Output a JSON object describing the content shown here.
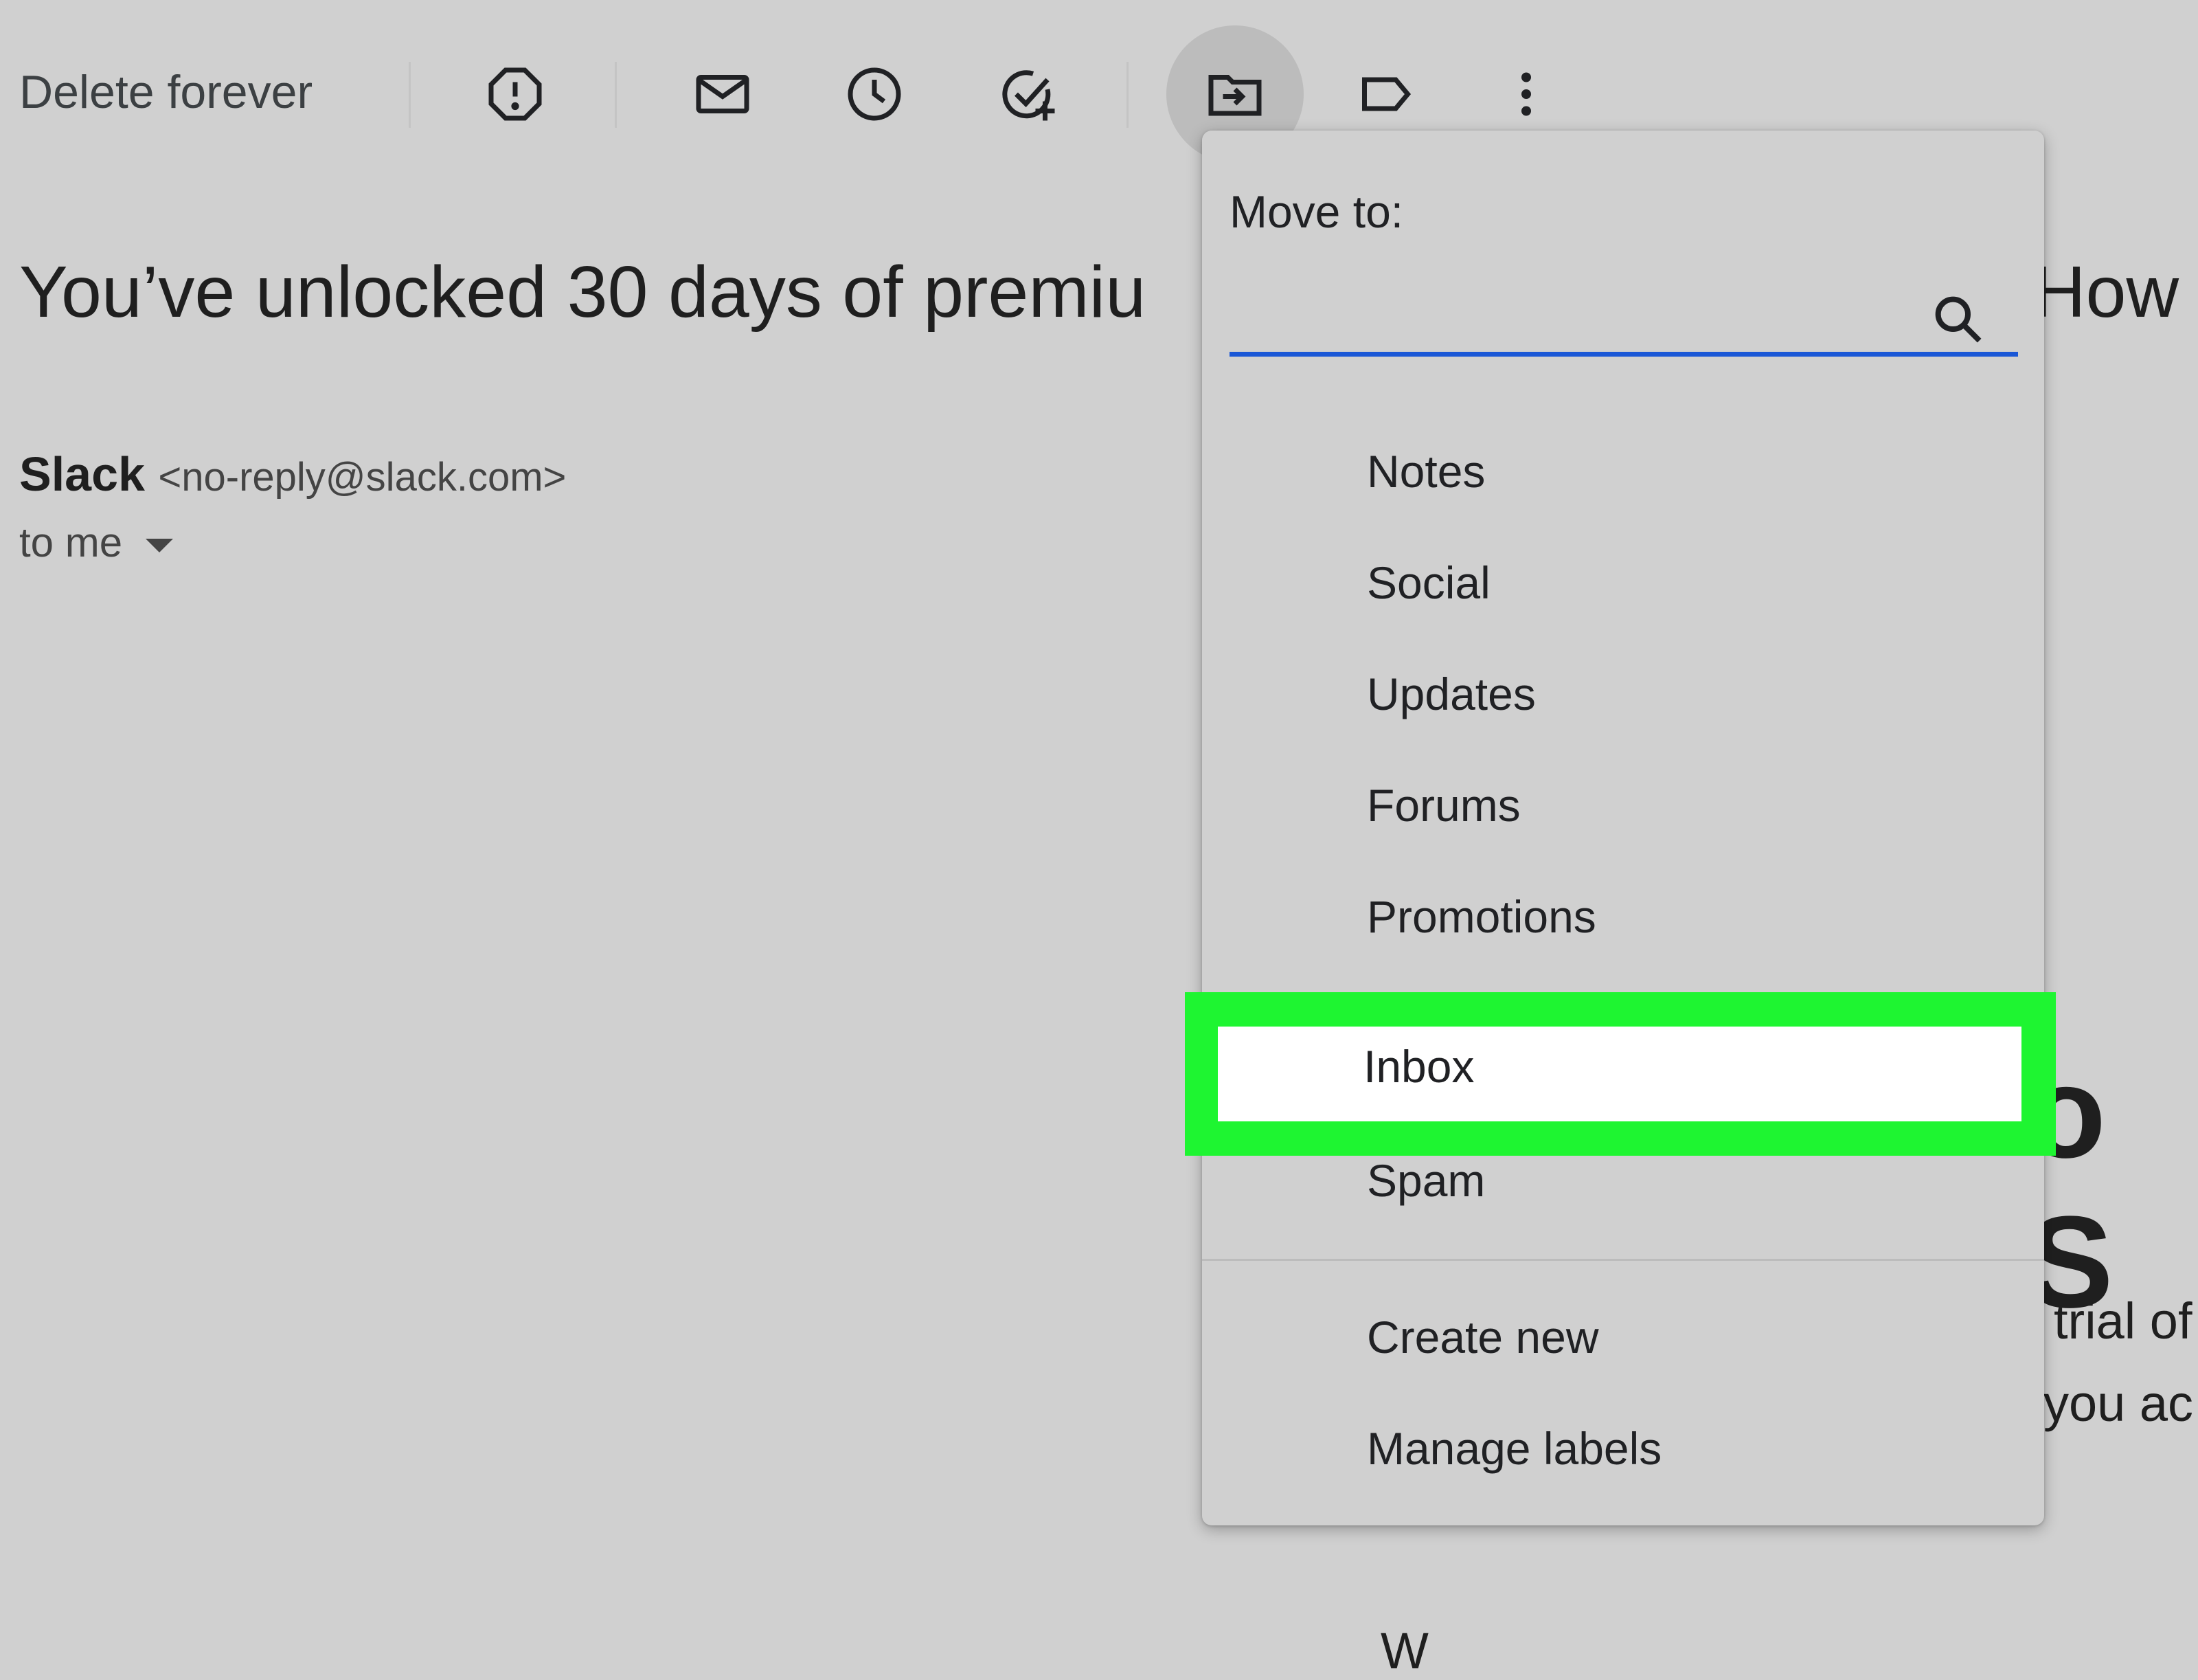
{
  "toolbar": {
    "delete_label": "Delete forever",
    "icons": [
      "report-spam-icon",
      "mark-unread-icon",
      "snooze-icon",
      "add-task-icon",
      "move-to-icon",
      "label-icon",
      "more-icon"
    ]
  },
  "email": {
    "subject_visible": "You’ve unlocked 30 days of premiu",
    "subject_tail": "How",
    "sender_name": "Slack",
    "sender_email": "<no-reply@slack.com>",
    "recipient": "to me"
  },
  "background_fragments": {
    "big": "o S",
    "line1": "trial of",
    "line2": "you ac",
    "bottom": "W"
  },
  "menu": {
    "title": "Move to:",
    "search_value": "",
    "items": [
      "Notes",
      "Social",
      "Updates",
      "Forums",
      "Promotions",
      "Inbox",
      "Spam"
    ],
    "footer_items": [
      "Create new",
      "Manage labels"
    ],
    "highlighted_item": "Inbox"
  },
  "colors": {
    "background": "#d0d0d0",
    "highlight": "#1ef531",
    "search_underline": "#1a57d6"
  }
}
